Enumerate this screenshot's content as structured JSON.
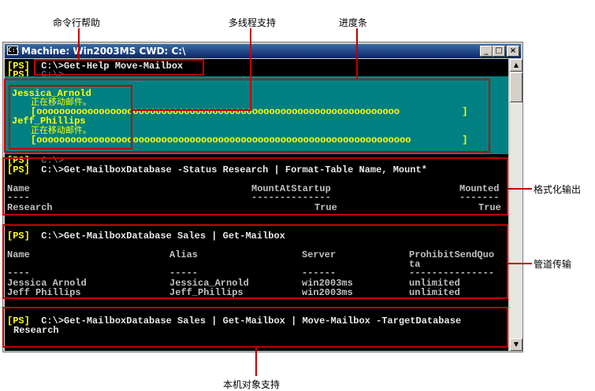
{
  "callouts": {
    "help": "命令行帮助",
    "multithread": "多线程支持",
    "progress": "进度条",
    "format": "格式化输出",
    "pipeline": "管道传输",
    "native": "本机对象支持"
  },
  "window": {
    "title": "Machine: Win2003MS CWD: C:\\",
    "icon_label": "C:\\",
    "min": "_",
    "max": "□",
    "close": "×"
  },
  "console": {
    "prompt": "[PS]",
    "line1_cmd": "C:\\>Get-Help Move-Mailbox",
    "line2_cmd": "C:\\>",
    "progress": {
      "user1": "Jessica_Arnold",
      "status1": "正在移动邮件。",
      "bar1": "[oooooooooooooooooooooooooooooooooooooooooooooooooooooooooooooooo           ]",
      "user2": "Jeff_Phillips",
      "status2": "正在移动邮件。",
      "bar2": "[oooooooooooooooooooooooooooooooooooooooooooooooooooooooooooooooooo         ]"
    },
    "line3_cmd": "C:\\>",
    "line4_cmd": "C:\\>Get-MailboxDatabase -Status Research | Format-Table Name, Mount*",
    "table1": {
      "headers": [
        "Name",
        "MountAtStartup",
        "Mounted"
      ],
      "dashes": [
        "----",
        "--------------",
        "-------"
      ],
      "row": [
        "Research",
        "True",
        "True"
      ]
    },
    "line5_cmd": "C:\\>Get-MailboxDatabase Sales | Get-Mailbox",
    "table2": {
      "headers": [
        "Name",
        "Alias",
        "Server",
        "ProhibitSendQuo",
        "ta"
      ],
      "dashes": [
        "----",
        "-----",
        "------",
        "---------------"
      ],
      "rows": [
        [
          "Jessica Arnold",
          "Jessica_Arnold",
          "win2003ms",
          "unlimited"
        ],
        [
          "Jeff Phillips",
          "Jeff_Phillips",
          "win2003ms",
          "unlimited"
        ]
      ]
    },
    "line6_cmd": "C:\\>Get-MailboxDatabase Sales | Get-Mailbox | Move-Mailbox -TargetDatabase",
    "line6_cont": "Research"
  },
  "colors": {
    "console_bg": "#000000",
    "prompt": "#ffff00",
    "progress_bg": "#008080",
    "callout_red": "#c00000",
    "title_bar": "#0a246a"
  }
}
